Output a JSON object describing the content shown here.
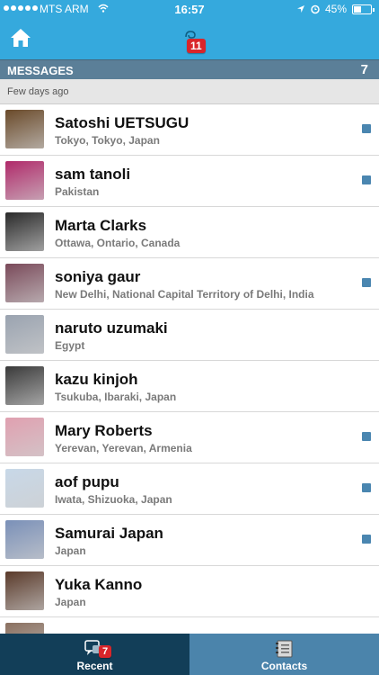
{
  "status_bar": {
    "carrier": "MTS ARM",
    "time": "16:57",
    "battery": "45%",
    "battery_level": 0.45
  },
  "nav": {
    "home_icon": "home-icon",
    "logo_badge": "11"
  },
  "messages_header": {
    "label": "MESSAGES",
    "count": "7"
  },
  "section": {
    "label": "Few days ago"
  },
  "conversations": [
    {
      "name": "Satoshi UETSUGU",
      "location": "Tokyo, Tokyo, Japan",
      "unread": true,
      "avatar_color": "#6a4a2a"
    },
    {
      "name": "sam tanoli",
      "location": "Pakistan",
      "unread": true,
      "avatar_color": "#b02a6a"
    },
    {
      "name": "Marta Clarks",
      "location": "Ottawa, Ontario, Canada",
      "unread": false,
      "avatar_color": "#2a2a2a"
    },
    {
      "name": "soniya gaur",
      "location": "New Delhi, National Capital Territory of Delhi, India",
      "unread": true,
      "avatar_color": "#7a4a5a"
    },
    {
      "name": "naruto uzumaki",
      "location": "Egypt",
      "unread": false,
      "avatar_color": "#9aa3b0"
    },
    {
      "name": "kazu kinjoh",
      "location": "Tsukuba, Ibaraki, Japan",
      "unread": false,
      "avatar_color": "#3a3a3a"
    },
    {
      "name": "Mary Roberts",
      "location": "Yerevan, Yerevan, Armenia",
      "unread": true,
      "avatar_color": "#e0a0b0"
    },
    {
      "name": "aof pupu",
      "location": "Iwata, Shizuoka, Japan",
      "unread": true,
      "avatar_color": "#c8d8e8"
    },
    {
      "name": "Samurai Japan",
      "location": "Japan",
      "unread": true,
      "avatar_color": "#7a90b8"
    },
    {
      "name": "Yuka Kanno",
      "location": "Japan",
      "unread": false,
      "avatar_color": "#5a3a2a"
    },
    {
      "name": "",
      "location": "",
      "unread": false,
      "avatar_color": "#8a7060"
    }
  ],
  "tabs": [
    {
      "label": "Recent",
      "icon": "chat-icon",
      "badge": "7",
      "active": true
    },
    {
      "label": "Contacts",
      "icon": "address-book-icon",
      "badge": "",
      "active": false
    }
  ],
  "colors": {
    "accent": "#35a9dd",
    "header": "#5b7f98",
    "unread": "#4a86b0",
    "tab_active": "#123e58",
    "tab_inactive": "#4b84ab",
    "badge": "#d9252a"
  }
}
